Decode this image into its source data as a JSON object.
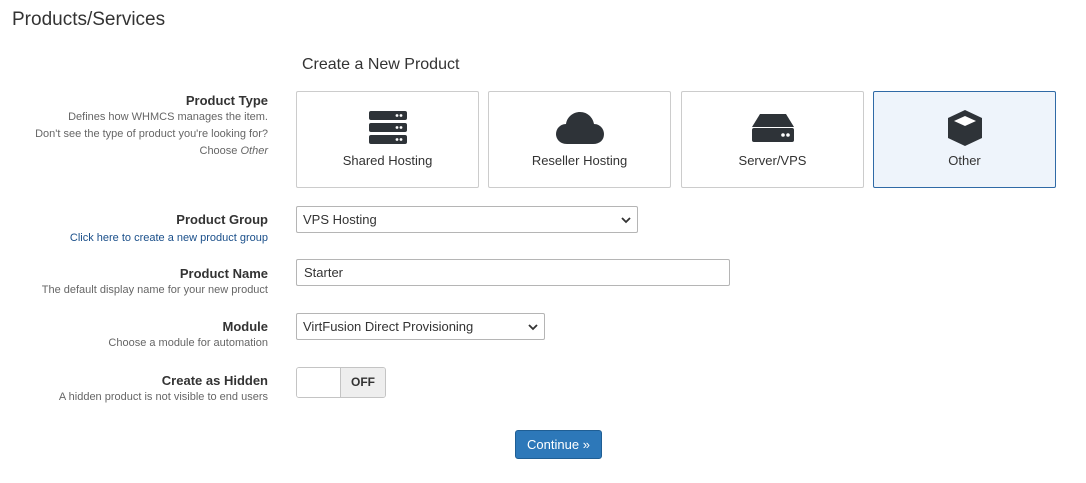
{
  "page": {
    "title": "Products/Services"
  },
  "form": {
    "heading": "Create a New Product",
    "product_type": {
      "label": "Product Type",
      "help_line1": "Defines how WHMCS manages the item.",
      "help_line2": "Don't see the type of product you're looking for?",
      "help_line3_prefix": "Choose",
      "help_line3_em": "Other",
      "options": [
        {
          "label": "Shared Hosting",
          "icon": "server-stack-icon",
          "selected": false
        },
        {
          "label": "Reseller Hosting",
          "icon": "cloud-icon",
          "selected": false
        },
        {
          "label": "Server/VPS",
          "icon": "hard-drive-icon",
          "selected": false
        },
        {
          "label": "Other",
          "icon": "cube-icon",
          "selected": true
        }
      ]
    },
    "product_group": {
      "label": "Product Group",
      "link": "Click here to create a new product group",
      "value": "VPS Hosting"
    },
    "product_name": {
      "label": "Product Name",
      "help": "The default display name for your new product",
      "value": "Starter"
    },
    "module": {
      "label": "Module",
      "help": "Choose a module for automation",
      "value": "VirtFusion Direct Provisioning"
    },
    "hidden": {
      "label": "Create as Hidden",
      "help": "A hidden product is not visible to end users",
      "state_label": "OFF"
    },
    "submit_label": "Continue »"
  },
  "colors": {
    "accent": "#2d78b9",
    "selected_card_bg": "#eef4fb",
    "icon": "#2e3338",
    "link": "#1a4f8a"
  }
}
